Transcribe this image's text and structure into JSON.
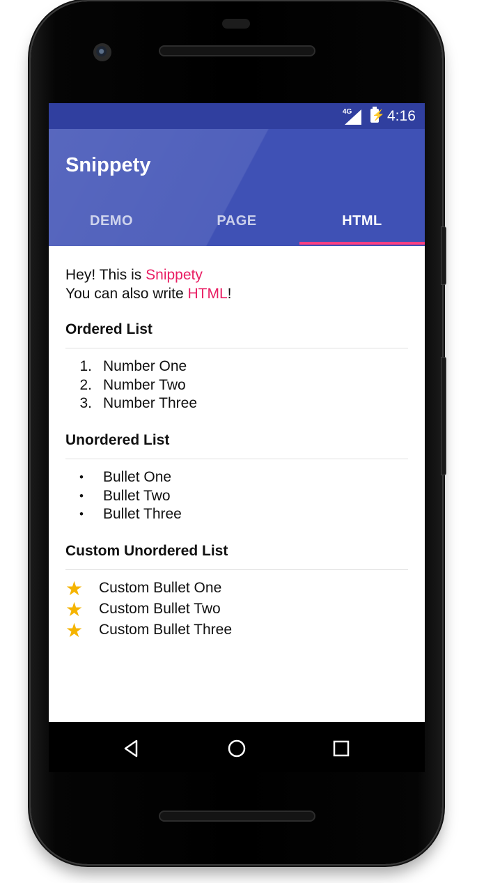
{
  "status": {
    "network": "4G",
    "time": "4:16"
  },
  "app": {
    "title": "Snippety"
  },
  "tabs": [
    {
      "label": "DEMO",
      "active": false
    },
    {
      "label": "PAGE",
      "active": false
    },
    {
      "label": "HTML",
      "active": true
    }
  ],
  "intro": {
    "line1_prefix": "Hey! This is ",
    "line1_link": "Snippety",
    "line2_prefix": "You can also write ",
    "line2_link": "HTML",
    "line2_suffix": "!"
  },
  "ordered": {
    "heading": "Ordered List",
    "items": [
      {
        "number": "1.",
        "text": "Number One"
      },
      {
        "number": "2.",
        "text": "Number Two"
      },
      {
        "number": "3.",
        "text": "Number Three"
      }
    ]
  },
  "unordered": {
    "heading": "Unordered List",
    "bullet": "•",
    "items": [
      "Bullet One",
      "Bullet Two",
      "Bullet Three"
    ]
  },
  "custom": {
    "heading": "Custom Unordered List",
    "bullet": "★",
    "items": [
      "Custom Bullet One",
      "Custom Bullet Two",
      "Custom Bullet Three"
    ]
  },
  "colors": {
    "primary": "#3f51b5",
    "primary_dark": "#303f9f",
    "accent": "#ff4081",
    "link": "#e91e63",
    "star": "#f5b400"
  },
  "nav_icons": [
    "back-icon",
    "home-icon",
    "recents-icon"
  ]
}
